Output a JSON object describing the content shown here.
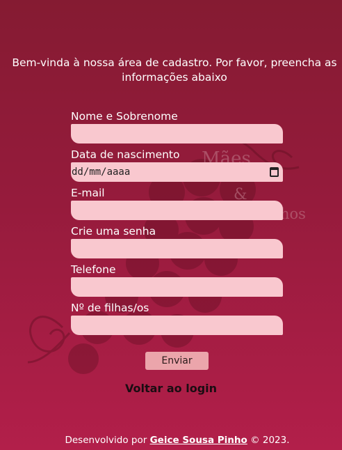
{
  "intro_text": "Bem-vinda à nossa área de cadastro. Por favor, preencha as informações abaixo",
  "background_logo": {
    "line1": "Mães",
    "line2": "&",
    "line3": "hos"
  },
  "form": {
    "fields": [
      {
        "label": "Nome e Sobrenome",
        "value": ""
      },
      {
        "label": "Data de nascimento",
        "value": "dd/mm/aaaa"
      },
      {
        "label": "E-mail",
        "value": ""
      },
      {
        "label": "Crie uma senha",
        "value": ""
      },
      {
        "label": "Telefone",
        "value": ""
      },
      {
        "label": "Nº de filhas/os",
        "value": ""
      }
    ],
    "submit_label": "Enviar"
  },
  "back_link": "Voltar ao login",
  "footer": {
    "prefix": "Desenvolvido por ",
    "author": "Geice Sousa Pinho",
    "suffix": " © 2023."
  },
  "colors": {
    "bg_top": "#851b32",
    "bg_bottom": "#b21f4a",
    "input_bg": "#f9c8cf",
    "button_bg": "#eba5ab"
  }
}
